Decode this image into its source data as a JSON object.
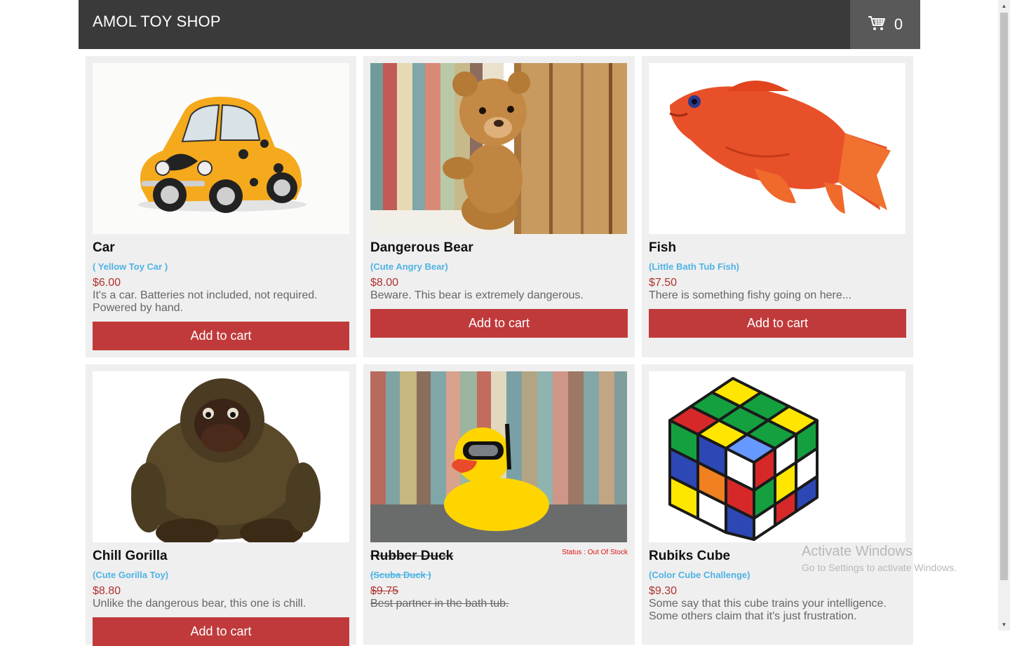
{
  "header": {
    "brand": "AMOL TOY SHOP",
    "cart_count": "0",
    "cart_icon": "shopping-cart-icon"
  },
  "colors": {
    "header_bg": "#3a3a3a",
    "cart_bg": "#595959",
    "button": "#c03a3b",
    "price": "#b0322f",
    "subtitle": "#4fb3e3"
  },
  "products": [
    {
      "title": "Car",
      "subtitle": "( Yellow Toy Car )",
      "price": "$6.00",
      "desc_lines": [
        "It's a car. Batteries not included, not required.",
        "Powered by hand."
      ],
      "button": "Add to cart",
      "image": "yellow-toy-car"
    },
    {
      "title": "Dangerous Bear",
      "subtitle": "(Cute Angry Bear)",
      "price": "$8.00",
      "desc_lines": [
        "Beware. This bear is extremely dangerous."
      ],
      "button": "Add to cart",
      "image": "teddy-bear"
    },
    {
      "title": "Fish",
      "subtitle": "(Little Bath Tub Fish)",
      "price": "$7.50",
      "desc_lines": [
        "There is something fishy going on here..."
      ],
      "button": "Add to cart",
      "image": "red-fish"
    },
    {
      "title": "Chill Gorilla",
      "subtitle": "(Cute Gorilla Toy)",
      "price": "$8.80",
      "desc_lines": [
        "Unlike the dangerous bear, this one is chill."
      ],
      "button": "Add to cart",
      "image": "plush-gorilla"
    },
    {
      "title": "Rubber Duck",
      "subtitle": "(Scuba Duck )",
      "price": "$9.75",
      "desc_lines": [
        "Best partner in the bath tub."
      ],
      "status": "Status : Out Of Stock",
      "image": "rubber-duck"
    },
    {
      "title": "Rubiks Cube",
      "subtitle": "(Color Cube Challenge)",
      "price": "$9.30",
      "desc_lines": [
        "Some say that this cube trains your intelligence.",
        "Some others claim that it's just frustration."
      ],
      "image": "rubiks-cube"
    }
  ],
  "watermark": {
    "title": "Activate Windows",
    "subtitle": "Go to Settings to activate Windows."
  }
}
